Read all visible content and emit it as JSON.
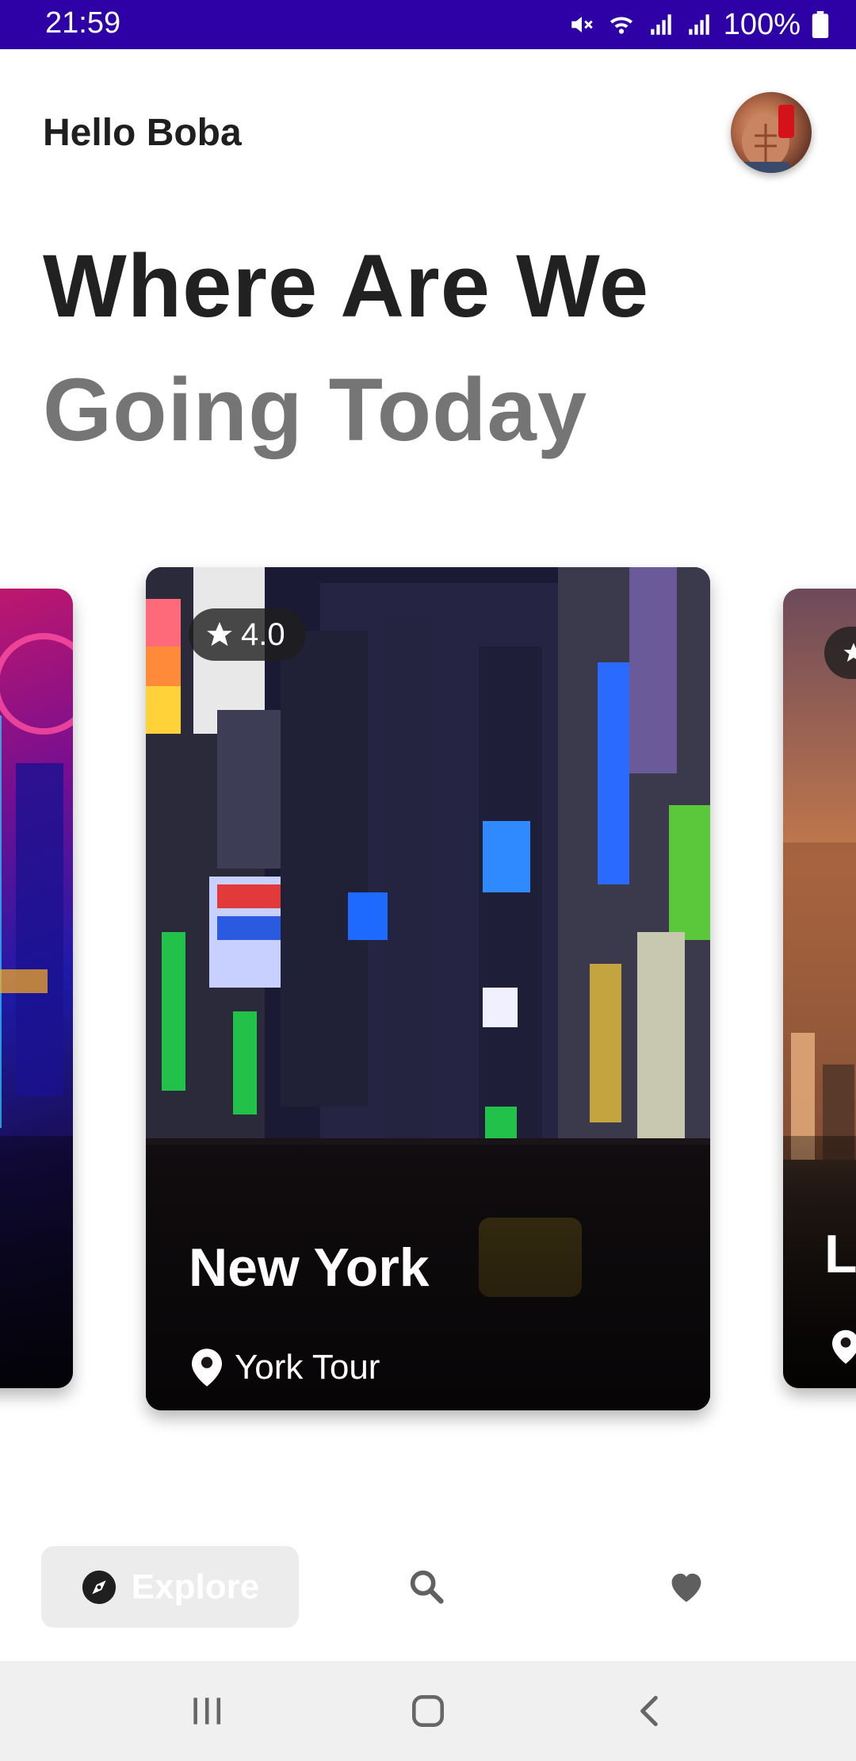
{
  "status_bar": {
    "time": "21:59",
    "battery": "100%"
  },
  "header": {
    "greeting": "Hello Boba"
  },
  "headline": {
    "line1": "Where Are We",
    "line2": "Going Today"
  },
  "cards": [
    {
      "rating": "4.0",
      "title": "New York",
      "location": "York Tour"
    }
  ],
  "right_peek": {
    "title_fragment": "L"
  },
  "bottom_nav": {
    "explore_label": "Explore"
  },
  "colors": {
    "status_bar": "#2e01a6",
    "headline_dark": "#212121",
    "headline_grey": "#757575"
  }
}
